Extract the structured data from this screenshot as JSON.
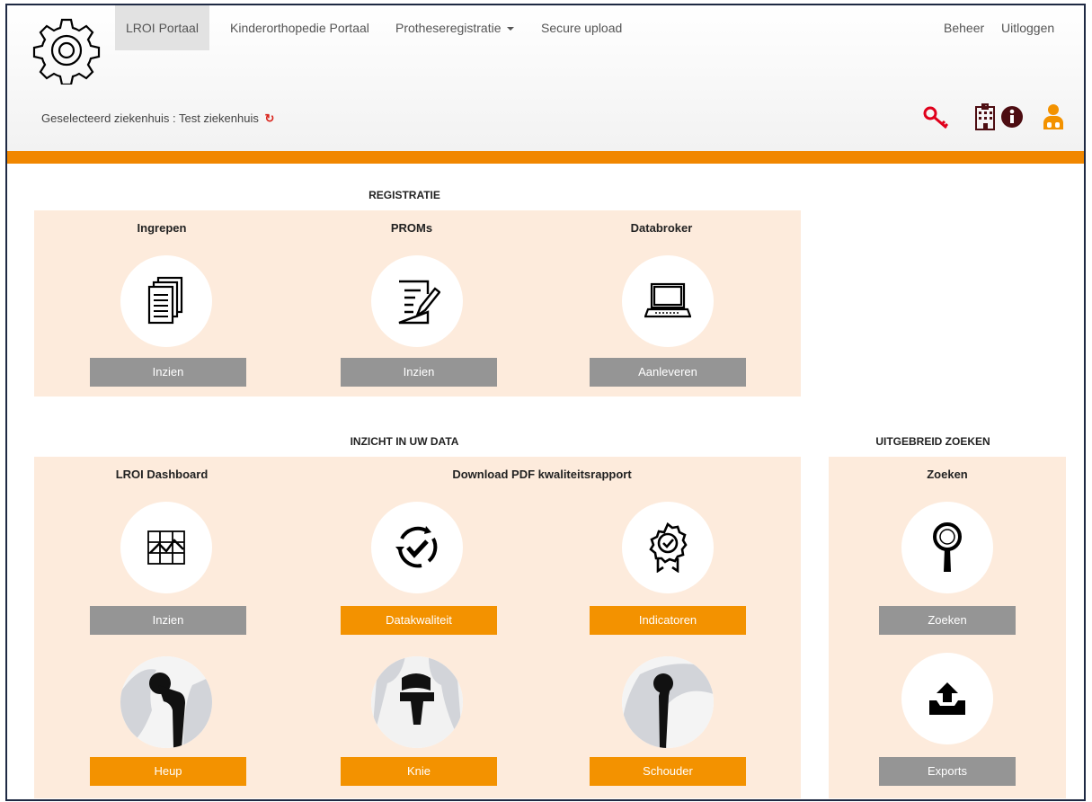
{
  "nav": {
    "items": [
      "LROI Portaal",
      "Kinderorthopedie Portaal",
      "Protheseregistratie",
      "Secure upload"
    ],
    "right": [
      "Beheer",
      "Uitloggen"
    ]
  },
  "hospital": {
    "label": "Geselecteerd ziekenhuis : Test ziekenhuis",
    "refresh_icon": "↻"
  },
  "colors": {
    "accent": "#f18700",
    "panel": "#fdebdc",
    "button_gray": "#959595",
    "button_orange": "#f39200",
    "key": "#e0001b",
    "info": "#4d0d12"
  },
  "registratie": {
    "title": "REGISTRATIE",
    "columns": [
      {
        "title": "Ingrepen",
        "icon": "documents-icon",
        "button": "Inzien"
      },
      {
        "title": "PROMs",
        "icon": "form-pen-icon",
        "button": "Inzien"
      },
      {
        "title": "Databroker",
        "icon": "laptop-icon",
        "button": "Aanleveren"
      }
    ]
  },
  "inzicht": {
    "title": "INZICHT IN UW DATA",
    "col1_title": "LROI Dashboard",
    "col23_title": "Download PDF kwaliteitsrapport",
    "row1": [
      {
        "icon": "chart-icon",
        "button": "Inzien"
      },
      {
        "icon": "check-cycle-icon",
        "button": "Datakwaliteit"
      },
      {
        "icon": "award-icon",
        "button": "Indicatoren"
      }
    ],
    "row2": [
      {
        "icon": "hip-prosthesis-icon",
        "button": "Heup"
      },
      {
        "icon": "knee-prosthesis-icon",
        "button": "Knie"
      },
      {
        "icon": "shoulder-prosthesis-icon",
        "button": "Schouder"
      }
    ]
  },
  "zoeken": {
    "title": "UITGEBREID ZOEKEN",
    "col_title": "Zoeken",
    "search_button": "Zoeken",
    "export_button": "Exports"
  }
}
